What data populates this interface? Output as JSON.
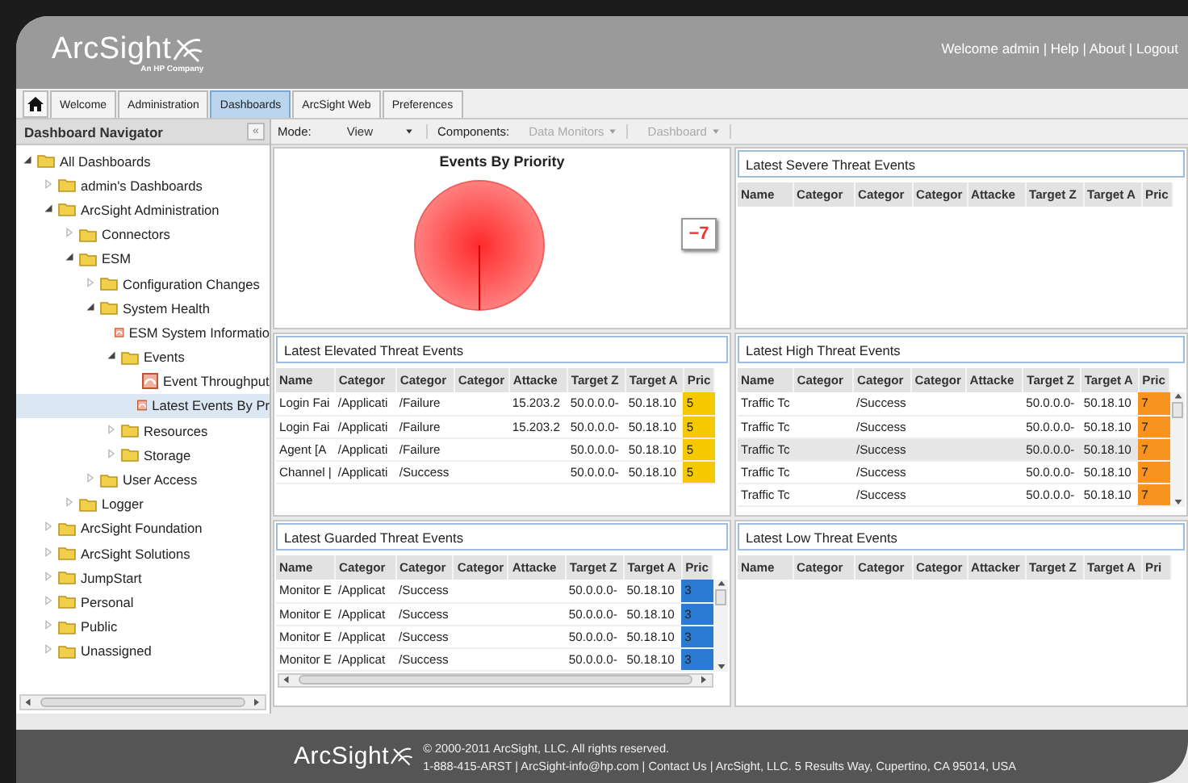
{
  "header": {
    "logo": "ArcSight",
    "tagline": "An HP Company",
    "user_links": "Welcome admin | Help | About | Logout"
  },
  "tabs": [
    {
      "label": "Welcome",
      "selected": false
    },
    {
      "label": "Administration",
      "selected": false
    },
    {
      "label": "Dashboards",
      "selected": true
    },
    {
      "label": "ArcSight Web",
      "selected": false
    },
    {
      "label": "Preferences",
      "selected": false
    }
  ],
  "navigator": {
    "title": "Dashboard Navigator",
    "collapse": "«",
    "tree": [
      {
        "label": "All Dashboards",
        "kind": "folder",
        "expanded": true,
        "selected": false,
        "children": [
          {
            "label": "admin's Dashboards",
            "kind": "folder",
            "expanded": false,
            "selected": false
          },
          {
            "label": "ArcSight Administration",
            "kind": "folder",
            "expanded": true,
            "selected": false,
            "children": [
              {
                "label": "Connectors",
                "kind": "folder",
                "expanded": false,
                "selected": false
              },
              {
                "label": "ESM",
                "kind": "folder",
                "expanded": true,
                "selected": false,
                "children": [
                  {
                    "label": "Configuration Changes",
                    "kind": "folder",
                    "expanded": false,
                    "selected": false
                  },
                  {
                    "label": "System Health",
                    "kind": "folder",
                    "expanded": true,
                    "selected": false,
                    "children": [
                      {
                        "label": "ESM System Informatio",
                        "kind": "dashboard",
                        "selected": false
                      },
                      {
                        "label": "Events",
                        "kind": "folder",
                        "expanded": true,
                        "selected": false,
                        "children": [
                          {
                            "label": "Event Throughput",
                            "kind": "dashboard",
                            "selected": false
                          },
                          {
                            "label": "Latest Events By Pr",
                            "kind": "dashboard",
                            "selected": true
                          }
                        ]
                      },
                      {
                        "label": "Resources",
                        "kind": "folder",
                        "expanded": false,
                        "selected": false
                      },
                      {
                        "label": "Storage",
                        "kind": "folder",
                        "expanded": false,
                        "selected": false
                      }
                    ]
                  },
                  {
                    "label": "User Access",
                    "kind": "folder",
                    "expanded": false,
                    "selected": false
                  }
                ]
              },
              {
                "label": "Logger",
                "kind": "folder",
                "expanded": false,
                "selected": false
              }
            ]
          },
          {
            "label": "ArcSight Foundation",
            "kind": "folder",
            "expanded": false,
            "selected": false
          },
          {
            "label": "ArcSight Solutions",
            "kind": "folder",
            "expanded": false,
            "selected": false
          },
          {
            "label": "JumpStart",
            "kind": "folder",
            "expanded": false,
            "selected": false
          },
          {
            "label": "Personal",
            "kind": "folder",
            "expanded": false,
            "selected": false
          },
          {
            "label": "Public",
            "kind": "folder",
            "expanded": false,
            "selected": false
          },
          {
            "label": "Unassigned",
            "kind": "folder",
            "expanded": false,
            "selected": false
          }
        ]
      }
    ]
  },
  "toolbar": {
    "mode_label": "Mode:",
    "mode": "View",
    "components_label": "Components:",
    "menus": [
      {
        "label": "Data Monitors",
        "disabled": true
      },
      {
        "label": "Dashboard",
        "disabled": true
      }
    ]
  },
  "chart_panel": {
    "title": "Events By Priority",
    "callout": "−7"
  },
  "tables": [
    {
      "title": "Latest Severe Threat Events",
      "scrollable": false,
      "columns": [
        "Name",
        "Categor",
        "Categor",
        "Categor",
        "Attacke",
        "Target Z",
        "Target A",
        "Pric"
      ]
    },
    {
      "title": "Latest Elevated Threat Events",
      "scrollable": false,
      "color": "#f5c800",
      "columns": [
        "Name",
        "Categor",
        "Categor",
        "Categor",
        "Attacke",
        "Target Z",
        "Target A",
        "Pric"
      ],
      "rows": [
        {
          "selected": false,
          "cells": [
            "Login Fai",
            "/Applicati",
            "/Failure",
            null,
            "15.203.2",
            "50.0.0.0-",
            "50.18.10",
            "5"
          ]
        },
        {
          "selected": false,
          "cells": [
            "Login Fai",
            "/Applicati",
            "/Failure",
            null,
            "15.203.2",
            "50.0.0.0-",
            "50.18.10",
            "5"
          ]
        },
        {
          "selected": false,
          "cells": [
            "Agent [A",
            "/Applicati",
            "/Failure",
            null,
            null,
            "50.0.0.0-",
            "50.18.10",
            "5"
          ]
        },
        {
          "selected": false,
          "cells": [
            "Channel |",
            "/Applicati",
            "/Success",
            null,
            null,
            "50.0.0.0-",
            "50.18.10",
            "5"
          ]
        }
      ]
    },
    {
      "title": "Latest High Threat Events",
      "scrollable": true,
      "color": "#f7931e",
      "columns": [
        "Name",
        "Categor",
        "Categor",
        "Categor",
        "Attacke",
        "Target Z",
        "Target A",
        "Pric"
      ],
      "rows": [
        {
          "selected": false,
          "cells": [
            "Traffic Tc",
            null,
            "/Success",
            null,
            null,
            "50.0.0.0-",
            "50.18.10",
            "7"
          ]
        },
        {
          "selected": false,
          "cells": [
            "Traffic Tc",
            null,
            "/Success",
            null,
            null,
            "50.0.0.0-",
            "50.18.10",
            "7"
          ]
        },
        {
          "selected": true,
          "cells": [
            "Traffic Tc",
            null,
            "/Success",
            null,
            null,
            "50.0.0.0-",
            "50.18.10",
            "7"
          ]
        },
        {
          "selected": false,
          "cells": [
            "Traffic Tc",
            null,
            "/Success",
            null,
            null,
            "50.0.0.0-",
            "50.18.10",
            "7"
          ]
        },
        {
          "selected": false,
          "cells": [
            "Traffic Tc",
            null,
            "/Success",
            null,
            null,
            "50.0.0.0-",
            "50.18.10",
            "7"
          ]
        }
      ]
    },
    {
      "title": "Latest Guarded Threat Events",
      "scrollable": true,
      "color": "#2a7ad2",
      "columns": [
        "Name",
        "Categor",
        "Categor",
        "Categor",
        "Attacke",
        "Target Z",
        "Target A",
        "Pric"
      ],
      "rows": [
        {
          "selected": false,
          "cells": [
            "Monitor E",
            "/Applicat",
            "/Success",
            null,
            null,
            "50.0.0.0-",
            "50.18.10",
            "3"
          ]
        },
        {
          "selected": false,
          "cells": [
            "Monitor E",
            "/Applicat",
            "/Success",
            null,
            null,
            "50.0.0.0-",
            "50.18.10",
            "3"
          ]
        },
        {
          "selected": false,
          "cells": [
            "Monitor E",
            "/Applicat",
            "/Success",
            null,
            null,
            "50.0.0.0-",
            "50.18.10",
            "3"
          ]
        },
        {
          "selected": false,
          "cells": [
            "Monitor E",
            "/Applicat",
            "/Success",
            null,
            null,
            "50.0.0.0-",
            "50.18.10",
            "3"
          ]
        }
      ]
    },
    {
      "title": "Latest Low Threat Events",
      "scrollable": false,
      "columns": [
        "Name",
        "Categor",
        "Categor",
        "Categor",
        "Attacker",
        "Target Z",
        "Target A",
        "Pri"
      ]
    }
  ],
  "footer": {
    "logo": "ArcSight",
    "copyright": "© 2000-2011 ArcSight, LLC. All rights reserved.",
    "contact": "1-888-415-ARST | ArcSight-info@hp.com | Contact Us | ArcSight, LLC. 5 Results Way, Cupertino, CA 95014, USA"
  }
}
